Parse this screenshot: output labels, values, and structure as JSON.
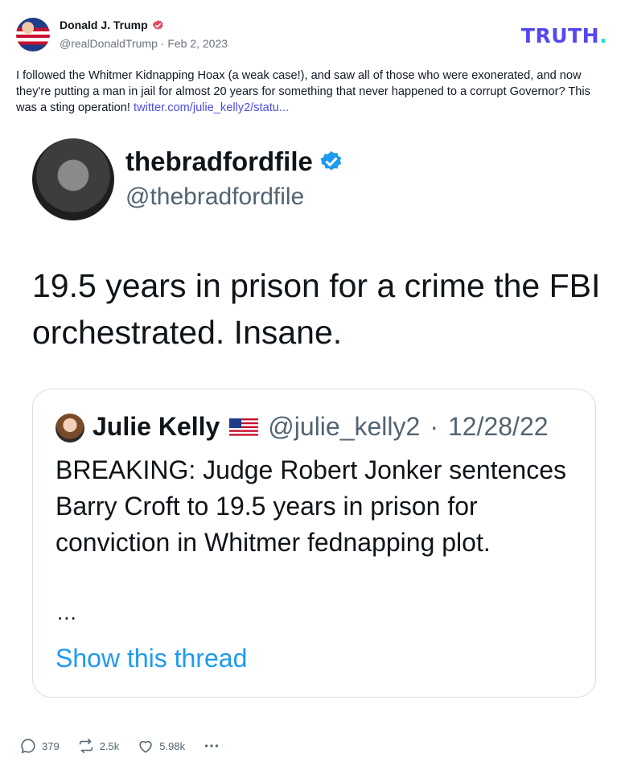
{
  "author": {
    "display_name": "Donald J. Trump",
    "handle": "@realDonaldTrump",
    "separator": "·",
    "date": "Feb 2, 2023"
  },
  "brand": {
    "logo_text": "TRUTH",
    "logo_dot": ".",
    "primary_color": "#5448ee",
    "dot_color": "#17e8c9"
  },
  "post": {
    "text": "I followed the Whitmer Kidnapping Hoax (a weak case!), and saw all of those who were exonerated, and now they're putting a man in jail for almost 20 years for something that never happened to a corrupt Governor? This was a sting operation!",
    "link_text": "twitter.com/julie_kelly2/statu..."
  },
  "embedded_tweet": {
    "name": "thebradfordfile",
    "handle": "@thebradfordfile",
    "text": "19.5 years in prison for a crime the FBI orchestrated. Insane.",
    "quote": {
      "name": "Julie Kelly",
      "flag_icon": "us-flag-icon",
      "handle": "@julie_kelly2",
      "separator": "·",
      "date": "12/28/22",
      "text": "BREAKING: Judge Robert Jonker sentences Barry Croft to 19.5 years in prison for conviction in Whitmer fednapping plot.",
      "ellipsis": "...",
      "show_thread": "Show this thread"
    }
  },
  "actions": {
    "replies": "379",
    "retruths": "2.5k",
    "likes": "5.98k"
  },
  "icons": [
    "verified-icon",
    "reply-icon",
    "retruth-icon",
    "like-icon",
    "more-icon"
  ]
}
